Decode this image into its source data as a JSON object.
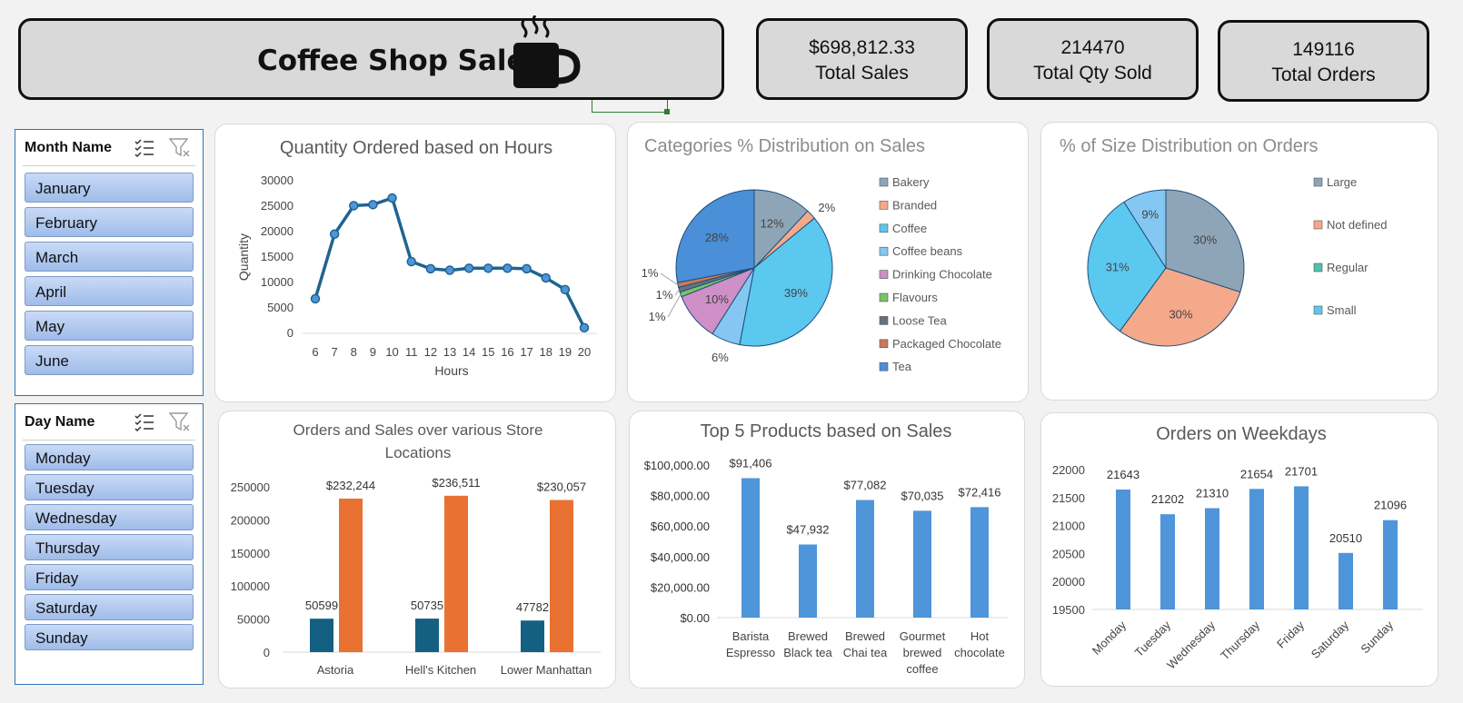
{
  "header": {
    "title": "Coffee Shop Sales",
    "icon": "coffee-cup-icon"
  },
  "kpis": [
    {
      "value": "$698,812.33",
      "label": "Total Sales"
    },
    {
      "value": "214470",
      "label": "Total Qty Sold"
    },
    {
      "value": "149116",
      "label": "Total Orders"
    }
  ],
  "slicers": {
    "month": {
      "title": "Month Name",
      "items": [
        "January",
        "February",
        "March",
        "April",
        "May",
        "June"
      ]
    },
    "day": {
      "title": "Day Name",
      "items": [
        "Monday",
        "Tuesday",
        "Wednesday",
        "Thursday",
        "Friday",
        "Saturday",
        "Sunday"
      ]
    }
  },
  "colors": {
    "line": "#1f6491",
    "orange": "#e97132",
    "navy": "#156082",
    "blue": "#4e95d9"
  },
  "chart_data": [
    {
      "id": "hours",
      "type": "line",
      "title": "Quantity Ordered based on Hours",
      "xlabel": "Hours",
      "ylabel": "Quantity",
      "x": [
        6,
        7,
        8,
        9,
        10,
        11,
        12,
        13,
        14,
        15,
        16,
        17,
        18,
        19,
        20
      ],
      "y": [
        6800,
        19500,
        25100,
        25300,
        26600,
        14100,
        12700,
        12400,
        12800,
        12800,
        12800,
        12700,
        10900,
        8600,
        1100
      ],
      "yticks": [
        "30000",
        "25000",
        "20000",
        "15000",
        "10000",
        "5000",
        "0"
      ],
      "ylim": [
        0,
        30000
      ],
      "grid": false,
      "color": "#1f6491"
    },
    {
      "id": "categories",
      "type": "pie",
      "title": "Categories % Distribution on Sales",
      "legend_position": "right",
      "slices": [
        {
          "name": "Bakery",
          "value": 12,
          "label": "12%",
          "color": "#8ea5b8"
        },
        {
          "name": "Branded",
          "value": 2,
          "label": "2%",
          "color": "#f4a98a"
        },
        {
          "name": "Coffee",
          "value": 39,
          "label": "39%",
          "color": "#5bc8f0"
        },
        {
          "name": "Coffee beans",
          "value": 6,
          "label": "6%",
          "color": "#84c7f2"
        },
        {
          "name": "Drinking Chocolate",
          "value": 10,
          "label": "10%",
          "color": "#cf8fc7"
        },
        {
          "name": "Flavours",
          "value": 1,
          "label": "1%",
          "color": "#7ac36a"
        },
        {
          "name": "Loose Tea",
          "value": 1,
          "label": "1%",
          "color": "#66737f"
        },
        {
          "name": "Packaged Chocolate",
          "value": 1,
          "label": "1%",
          "color": "#c9785a"
        },
        {
          "name": "Tea",
          "value": 28,
          "label": "28%",
          "color": "#4a8fd8"
        }
      ]
    },
    {
      "id": "sizes",
      "type": "pie",
      "title": "% of Size Distribution on Orders",
      "legend_position": "right",
      "slices": [
        {
          "name": "Large",
          "value": 30,
          "label": "30%",
          "color": "#8ea5b8"
        },
        {
          "name": "Not defined",
          "value": 30,
          "label": "30%",
          "color": "#f4a98a"
        },
        {
          "name": "Regular",
          "value": 0,
          "label": "",
          "color": "#4dc4b0"
        },
        {
          "name": "Small",
          "value": 31,
          "label": "31%",
          "color": "#5bc8f0"
        },
        {
          "name": "",
          "value": 9,
          "label": "9%",
          "color": "#84c7f2"
        }
      ]
    },
    {
      "id": "stores",
      "type": "bar",
      "title_lines": [
        "Orders and Sales over various Store",
        "Locations"
      ],
      "categories": [
        "Astoria",
        "Hell's Kitchen",
        "Lower Manhattan"
      ],
      "series": [
        {
          "values": [
            50599,
            50735,
            47782
          ],
          "labels": [
            "50599",
            "50735",
            "47782"
          ],
          "color": "#156082"
        },
        {
          "values": [
            232244,
            236511,
            230057
          ],
          "labels": [
            "$232,244",
            "$236,511",
            "$230,057"
          ],
          "color": "#e97132"
        }
      ],
      "yticks": [
        "250000",
        "200000",
        "150000",
        "100000",
        "50000",
        "0"
      ],
      "ylim": [
        0,
        250000
      ],
      "grid": false
    },
    {
      "id": "products",
      "type": "bar",
      "title": "Top 5 Products based on Sales",
      "categories": [
        [
          "Barista",
          "Espresso"
        ],
        [
          "Brewed",
          "Black tea"
        ],
        [
          "Brewed",
          "Chai tea"
        ],
        [
          "Gourmet",
          "brewed",
          "coffee"
        ],
        [
          "Hot",
          "chocolate"
        ]
      ],
      "values": [
        91406,
        47932,
        77082,
        70035,
        72416
      ],
      "labels": [
        "$91,406",
        "$47,932",
        "$77,082",
        "$70,035",
        "$72,416"
      ],
      "yticks": [
        "$100,000.00",
        "$80,000.00",
        "$60,000.00",
        "$40,000.00",
        "$20,000.00",
        "$0.00"
      ],
      "ylim": [
        0,
        100000
      ],
      "color": "#4e95d9"
    },
    {
      "id": "weekdays",
      "type": "bar",
      "title": "Orders on Weekdays",
      "categories": [
        "Monday",
        "Tuesday",
        "Wednesday",
        "Thursday",
        "Friday",
        "Saturday",
        "Sunday"
      ],
      "values": [
        21643,
        21202,
        21310,
        21654,
        21701,
        20510,
        21096
      ],
      "labels": [
        "21643",
        "21202",
        "21310",
        "21654",
        "21701",
        "20510",
        "21096"
      ],
      "yticks": [
        "22000",
        "21500",
        "21000",
        "20500",
        "20000",
        "19500"
      ],
      "ylim": [
        19500,
        22000
      ],
      "color": "#4e95d9"
    }
  ]
}
